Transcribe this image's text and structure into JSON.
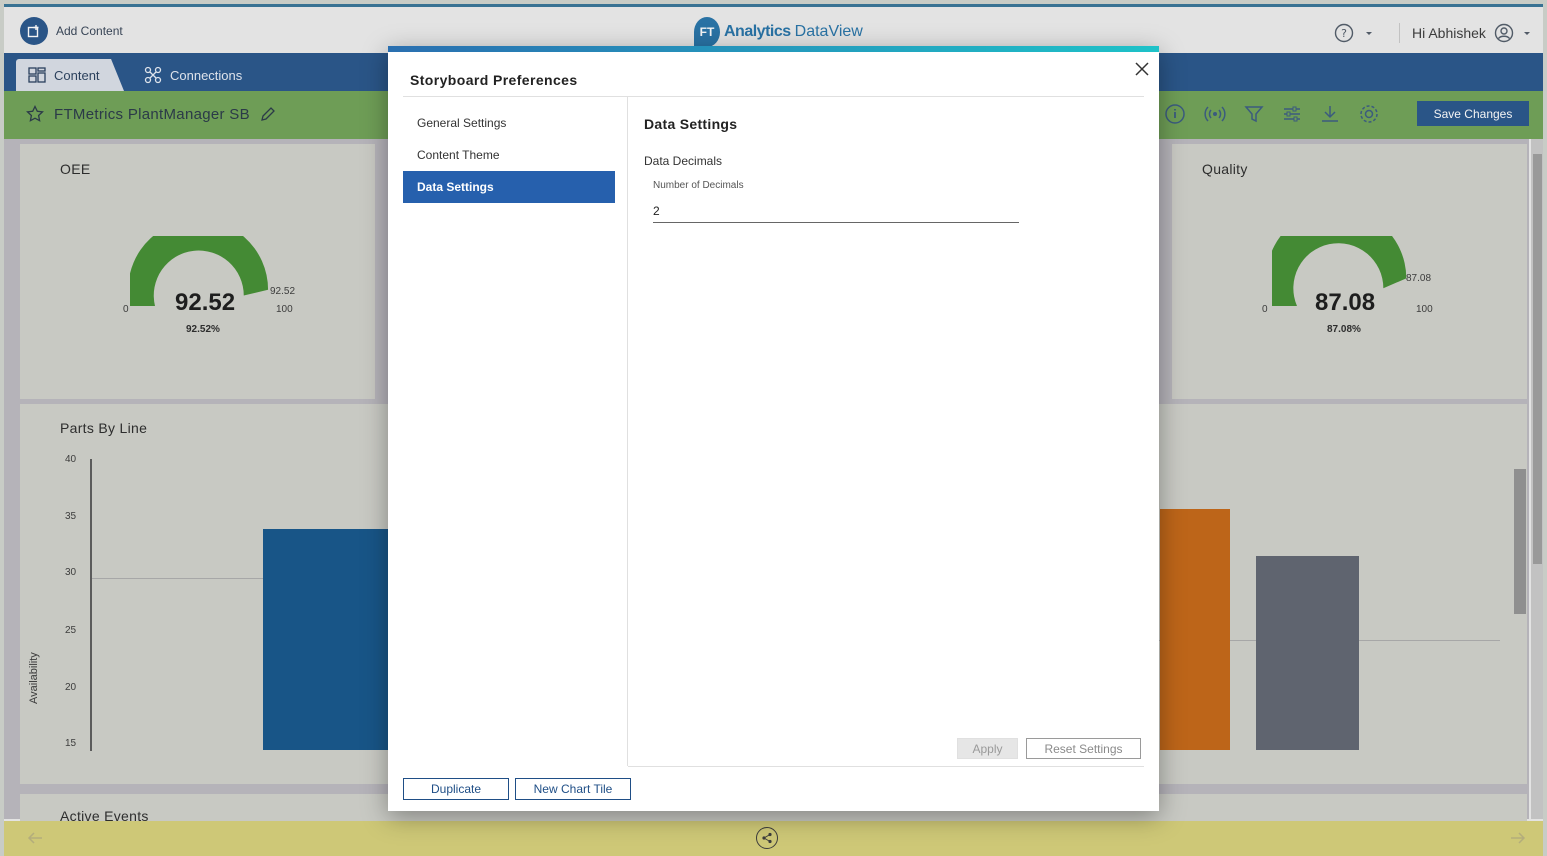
{
  "header": {
    "add_content": "Add Content",
    "brand_name": "Analytics",
    "brand_product": "DataView",
    "brand_logo": "FT",
    "greeting": "Hi Abhishek"
  },
  "nav": {
    "tabs": [
      {
        "label": "Content",
        "icon": "grid-icon"
      },
      {
        "label": "Connections",
        "icon": "connections-icon"
      }
    ]
  },
  "storyboard": {
    "title": "FTMetrics PlantManager SB",
    "save_label": "Save Changes"
  },
  "tiles": {
    "oee": {
      "title": "OEE",
      "value": "92.52",
      "percent": "92.52%",
      "min": "0",
      "max": "100",
      "marker": "92.52",
      "fraction": 0.9252
    },
    "quality": {
      "title": "Quality",
      "value": "87.08",
      "percent": "87.08%",
      "min": "0",
      "max": "100",
      "marker": "87.08",
      "fraction": 0.8708
    },
    "parts": {
      "title": "Parts By Line",
      "ylabel": "Availability",
      "yticks": [
        "40",
        "35",
        "30",
        "25",
        "20",
        "15"
      ]
    },
    "events": {
      "title": "Active Events"
    }
  },
  "modal": {
    "title": "Storyboard Preferences",
    "nav_items": [
      {
        "label": "General Settings",
        "active": false
      },
      {
        "label": "Content Theme",
        "active": false
      },
      {
        "label": "Data Settings",
        "active": true
      }
    ],
    "pane_title": "Data Settings",
    "section_label": "Data Decimals",
    "field_label": "Number of Decimals",
    "field_value": "2",
    "apply_label": "Apply",
    "reset_label": "Reset Settings",
    "duplicate_label": "Duplicate",
    "new_chart_label": "New Chart Tile"
  },
  "colors": {
    "primary": "#1f4e86",
    "active_nav": "#2660ad",
    "subbar": "#6a9f50",
    "gauge_green": "#3b8a2a",
    "bar_blue": "#0b4e86",
    "bar_orange": "#c2600c",
    "bar_gray": "#5a5f6b"
  }
}
